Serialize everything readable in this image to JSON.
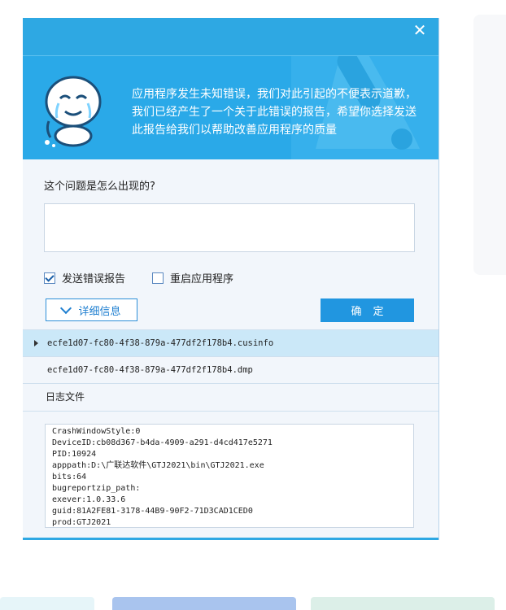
{
  "dialog": {
    "close_glyph": "✕",
    "banner_message": "应用程序发生未知错误，我们对此引起的不便表示道歉，我们已经产生了一个关于此错误的报告，希望你选择发送此报告给我们以帮助改善应用程序的质量",
    "question_label": "这个问题是怎么出现的?",
    "description_value": "",
    "send_report": {
      "label": "发送错误报告",
      "checked": true
    },
    "restart_app": {
      "label": "重启应用程序",
      "checked": false
    },
    "details_button": "详细信息",
    "ok_button": "确定",
    "files": [
      {
        "name": "ecfe1d07-fc80-4f38-879a-477df2f178b4.cusinfo",
        "selected": true
      },
      {
        "name": "ecfe1d07-fc80-4f38-879a-477df2f178b4.dmp",
        "selected": false
      }
    ],
    "log_header": "日志文件",
    "log_lines": [
      "CrashWindowStyle:0",
      "DeviceID:cb08d367-b4da-4909-a291-d4cd417e5271",
      "PID:10924",
      "apppath:D:\\广联达软件\\GTJ2021\\bin\\GTJ2021.exe",
      "bits:64",
      "bugreportzip_path:",
      "exever:1.0.33.6",
      "guid:81A2FE81-3178-44B9-90F2-71D3CAD1CED0",
      "prod:GTJ2021"
    ]
  },
  "colors": {
    "accent": "#2ea8e3",
    "button_primary": "#2196e0",
    "selected_row": "#cbe8f8"
  }
}
